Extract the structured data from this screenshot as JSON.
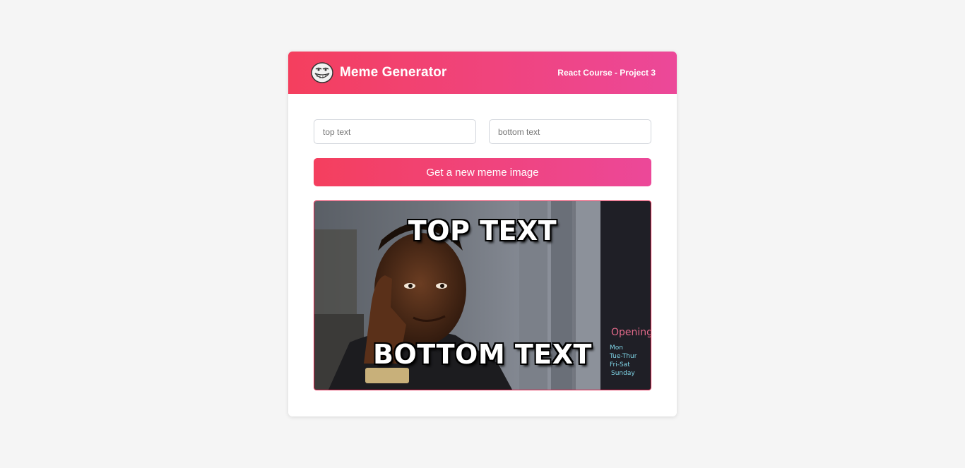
{
  "header": {
    "logo_icon": "troll-face-icon",
    "title": "Meme Generator",
    "course": "React Course - Project 3"
  },
  "form": {
    "top_input": {
      "value": "",
      "placeholder": "top text"
    },
    "bottom_input": {
      "value": "",
      "placeholder": "bottom text"
    },
    "button_label": "Get a new meme image"
  },
  "meme": {
    "image_icon": "meme-photo",
    "top_text": "TOP TEXT",
    "bottom_text": "BOTTOM TEXT"
  },
  "colors": {
    "accent_start": "#f43f5e",
    "accent_end": "#ec4899",
    "background": "#f5f5f5"
  }
}
